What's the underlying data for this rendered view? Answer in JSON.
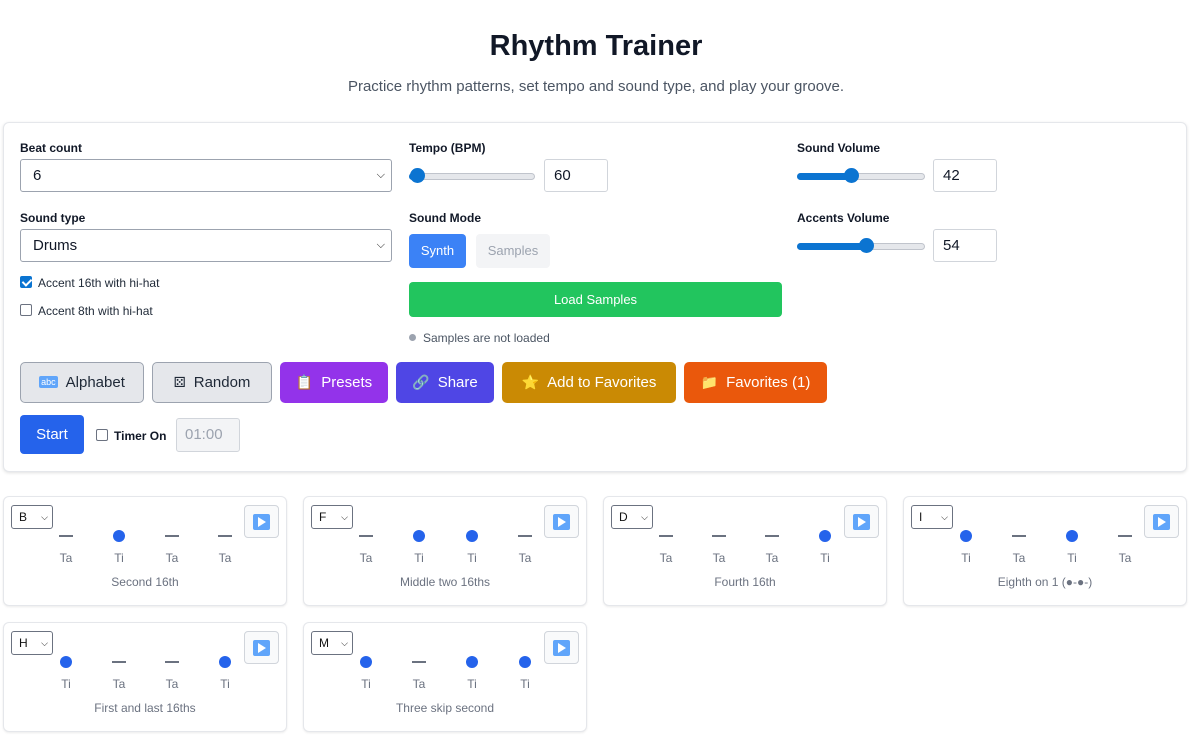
{
  "page": {
    "title": "Rhythm Trainer",
    "subtitle": "Practice rhythm patterns, set tempo and sound type, and play your groove."
  },
  "controls": {
    "beat_count_label": "Beat count",
    "beat_count_value": "6",
    "tempo_label": "Tempo (BPM)",
    "tempo_value": "60",
    "tempo_slider_fraction": 0.06,
    "sound_volume_label": "Sound Volume",
    "sound_volume_value": "42",
    "sound_type_label": "Sound type",
    "sound_type_value": "Drums",
    "sound_mode_label": "Sound Mode",
    "mode_synth": "Synth",
    "mode_samples": "Samples",
    "mode_active": "Synth",
    "accents_volume_label": "Accents Volume",
    "accents_volume_value": "54",
    "load_samples": "Load Samples",
    "samples_status": "Samples are not loaded",
    "accent16_label": "Accent 16th with hi-hat",
    "accent16_checked": true,
    "accent8_label": "Accent 8th with hi-hat",
    "accent8_checked": false
  },
  "actions": {
    "alphabet": "Alphabet",
    "random": "Random",
    "presets": "Presets",
    "share": "Share",
    "add_favorites": "Add to Favorites",
    "favorites": "Favorites (1)",
    "start": "Start",
    "timer_label": "Timer On",
    "timer_value": "01:00"
  },
  "colors": {
    "primary": "#2563eb",
    "synth": "#3b82f6",
    "load": "#22c55e",
    "presets": "#9333ea",
    "share": "#4f46e5",
    "add_favorites": "#ca8a04",
    "favorites": "#ea580c"
  },
  "icons": {
    "alphabet": "abc-icon",
    "random": "dice-icon",
    "presets": "clipboard-icon",
    "share": "link-icon",
    "add_favorites": "star-icon",
    "favorites": "folder-icon"
  },
  "cards": [
    {
      "letter": "B",
      "name": "Second 16th",
      "beats": [
        "dash",
        "dot",
        "dash",
        "dash"
      ],
      "syllables": [
        "Ta",
        "Ti",
        "Ta",
        "Ta"
      ]
    },
    {
      "letter": "F",
      "name": "Middle two 16ths",
      "beats": [
        "dash",
        "dot",
        "dot",
        "dash"
      ],
      "syllables": [
        "Ta",
        "Ti",
        "Ti",
        "Ta"
      ]
    },
    {
      "letter": "D",
      "name": "Fourth 16th",
      "beats": [
        "dash",
        "dash",
        "dash",
        "dot"
      ],
      "syllables": [
        "Ta",
        "Ta",
        "Ta",
        "Ti"
      ]
    },
    {
      "letter": "I",
      "name": "Eighth on 1 (●-●-)",
      "beats": [
        "dot",
        "dash",
        "dot",
        "dash"
      ],
      "syllables": [
        "Ti",
        "Ta",
        "Ti",
        "Ta"
      ]
    },
    {
      "letter": "H",
      "name": "First and last 16ths",
      "beats": [
        "dot",
        "dash",
        "dash",
        "dot"
      ],
      "syllables": [
        "Ti",
        "Ta",
        "Ta",
        "Ti"
      ]
    },
    {
      "letter": "M",
      "name": "Three skip second",
      "beats": [
        "dot",
        "dash",
        "dot",
        "dot"
      ],
      "syllables": [
        "Ti",
        "Ta",
        "Ti",
        "Ti"
      ]
    }
  ]
}
